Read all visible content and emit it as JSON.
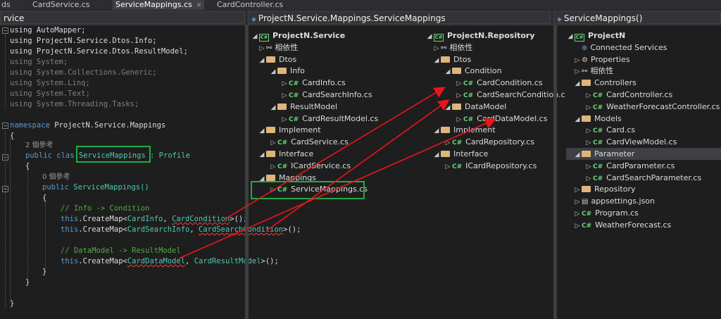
{
  "tabs": [
    {
      "label": "CardService.cs",
      "active": false
    },
    {
      "label": "ServiceMappings.cs",
      "active": true,
      "close": "✕"
    },
    {
      "label": "CardController.cs",
      "active": false
    }
  ],
  "tab_partial": "ds",
  "nav": {
    "left": "rvice",
    "middle": "ProjectN.Service.Mappings.ServiceMappings",
    "right": "ServiceMappings()"
  },
  "code": {
    "l0": "using AutoMapper;",
    "l1": "using ProjectN.Service.Dtos.Info;",
    "l2": "using ProjectN.Service.Dtos.ResultModel;",
    "l3": "using System;",
    "l4": "using System.Collections.Generic;",
    "l5": "using System.Linq;",
    "l6": "using System.Text;",
    "l7": "using System.Threading.Tasks;",
    "namespace_kw": "namespace",
    "namespace_name": "ProjectN.Service.Mappings",
    "brace_open": "{",
    "brace_close": "}",
    "refs_class": "2 個參考",
    "public_class": "public clas",
    "class_name": "ServiceMappings",
    "base_class": ": Profile",
    "refs_ctor": "0 個參考",
    "public_kw": "public",
    "ctor": "ServiceMappings()",
    "cmt1": "// Info -> Condition",
    "this_kw": "this",
    "create_map": ".CreateMap<",
    "a1": "CardInfo",
    "b1": "CardCondition",
    "a2": "CardSearchInfo",
    "b2": "CardSearchCondition",
    "call_end": ">();",
    "comma": ", ",
    "cmt2": "// DataModel -> ResultModel",
    "a3": "CardDataModel",
    "b3": "CardResultModel"
  },
  "service_tree": [
    {
      "label": "ProjectN.Service",
      "icon": "project-icon",
      "arrow": "◢"
    },
    {
      "label": "相依性",
      "icon": "dependency-icon",
      "arrow": "▷"
    },
    {
      "label": "Dtos",
      "icon": "folder-icon",
      "arrow": "◢"
    },
    {
      "label": "Info",
      "icon": "folder-icon",
      "arrow": "◢"
    },
    {
      "label": "CardInfo.cs",
      "icon": "csharp-file-icon",
      "arrow": "▷"
    },
    {
      "label": "CardSearchInfo.cs",
      "icon": "csharp-file-icon",
      "arrow": "▷"
    },
    {
      "label": "ResultModel",
      "icon": "folder-icon",
      "arrow": "◢"
    },
    {
      "label": "CardResultModel.cs",
      "icon": "csharp-file-icon",
      "arrow": "▷"
    },
    {
      "label": "Implement",
      "icon": "folder-icon",
      "arrow": "◢"
    },
    {
      "label": "CardService.cs",
      "icon": "csharp-file-icon",
      "arrow": "▷"
    },
    {
      "label": "Interface",
      "icon": "folder-icon",
      "arrow": "◢"
    },
    {
      "label": "ICardService.cs",
      "icon": "csharp-file-icon",
      "arrow": "▷"
    },
    {
      "label": "Mappings",
      "icon": "folder-icon",
      "arrow": "◢"
    },
    {
      "label": "ServiceMappings.cs",
      "icon": "csharp-file-icon",
      "arrow": "▷"
    }
  ],
  "repository_tree": [
    {
      "label": "ProjectN.Repository",
      "icon": "project-icon",
      "arrow": "◢"
    },
    {
      "label": "相依性",
      "icon": "dependency-icon",
      "arrow": "▷"
    },
    {
      "label": "Dtos",
      "icon": "folder-icon",
      "arrow": "◢"
    },
    {
      "label": "Condition",
      "icon": "folder-icon",
      "arrow": "◢"
    },
    {
      "label": "CardCondition.cs",
      "icon": "csharp-file-icon",
      "arrow": "▷"
    },
    {
      "label": "CardSearchCondition.c",
      "icon": "csharp-file-icon",
      "arrow": "▷"
    },
    {
      "label": "DataModel",
      "icon": "folder-icon",
      "arrow": "◢"
    },
    {
      "label": "CardDataModel.cs",
      "icon": "csharp-file-icon",
      "arrow": "▷"
    },
    {
      "label": "Implement",
      "icon": "folder-icon",
      "arrow": "◢"
    },
    {
      "label": "CardRepository.cs",
      "icon": "csharp-file-icon",
      "arrow": "▷"
    },
    {
      "label": "Interface",
      "icon": "folder-icon",
      "arrow": "◢"
    },
    {
      "label": "ICardRepository.cs",
      "icon": "csharp-file-icon",
      "arrow": "▷"
    }
  ],
  "web_tree": [
    {
      "label": "ProjectN",
      "icon": "web-project-icon",
      "arrow": "◢"
    },
    {
      "label": "Connected Services",
      "icon": "connected-services-icon",
      "arrow": ""
    },
    {
      "label": "Properties",
      "icon": "wrench-icon",
      "arrow": "▷"
    },
    {
      "label": "相依性",
      "icon": "dependency-icon",
      "arrow": "▷"
    },
    {
      "label": "Controllers",
      "icon": "folder-icon",
      "arrow": "◢"
    },
    {
      "label": "CardController.cs",
      "icon": "csharp-file-icon",
      "arrow": "▷"
    },
    {
      "label": "WeatherForecastController.cs",
      "icon": "csharp-file-icon",
      "arrow": "▷"
    },
    {
      "label": "Models",
      "icon": "folder-icon",
      "arrow": "◢"
    },
    {
      "label": "Card.cs",
      "icon": "csharp-file-icon",
      "arrow": "▷"
    },
    {
      "label": "CardViewModel.cs",
      "icon": "csharp-file-icon",
      "arrow": "▷"
    },
    {
      "label": "Parameter",
      "icon": "folder-icon",
      "arrow": "◢",
      "selected": true
    },
    {
      "label": "CardParameter.cs",
      "icon": "csharp-file-icon",
      "arrow": "▷"
    },
    {
      "label": "CardSearchParameter.cs",
      "icon": "csharp-file-icon",
      "arrow": "▷"
    },
    {
      "label": "Repository",
      "icon": "folder-icon",
      "arrow": "▷"
    },
    {
      "label": "appsettings.json",
      "icon": "json-file-icon",
      "arrow": "▷"
    },
    {
      "label": "Program.cs",
      "icon": "csharp-file-icon",
      "arrow": "▷"
    },
    {
      "label": "WeatherForecast.cs",
      "icon": "csharp-file-icon",
      "arrow": "▷"
    }
  ],
  "colors": {
    "arrow": "#e8161b",
    "highlight": "#22aa44"
  }
}
